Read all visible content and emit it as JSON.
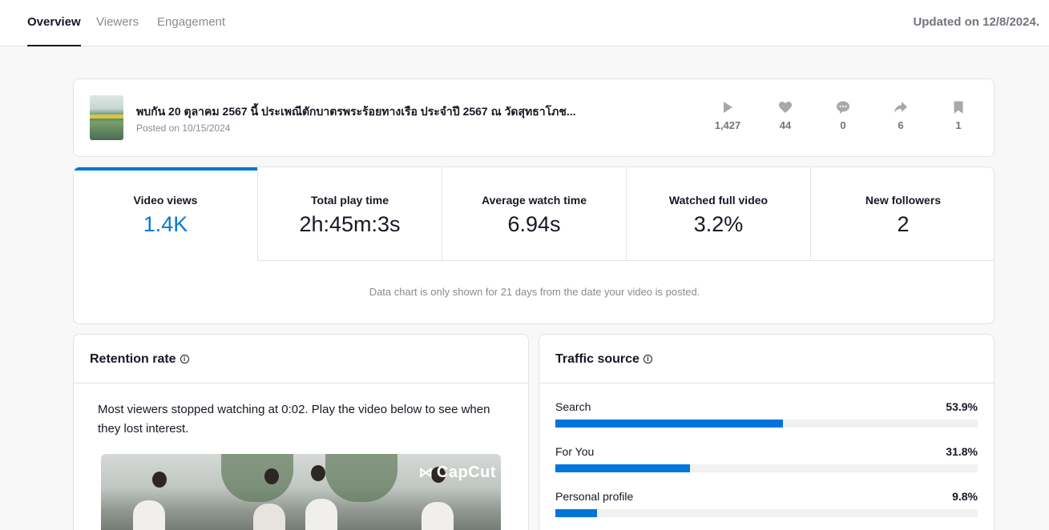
{
  "tabs": [
    {
      "label": "Overview",
      "active": true
    },
    {
      "label": "Viewers",
      "active": false
    },
    {
      "label": "Engagement",
      "active": false
    }
  ],
  "updated": "Updated on 12/8/2024.",
  "video": {
    "title": "พบกัน 20 ตุลาคม 2567 นี้ ประเพณีตักบาตรพระร้อยทางเรือ ประจำปี 2567 ณ วัดสุทธาโภช...",
    "posted": "Posted on 10/15/2024",
    "stats": {
      "plays": "1,427",
      "likes": "44",
      "comments": "0",
      "shares": "6",
      "saves": "1"
    }
  },
  "metrics": [
    {
      "label": "Video views",
      "value": "1.4K",
      "active": true
    },
    {
      "label": "Total play time",
      "value": "2h:45m:3s",
      "active": false
    },
    {
      "label": "Average watch time",
      "value": "6.94s",
      "active": false
    },
    {
      "label": "Watched full video",
      "value": "3.2%",
      "active": false
    },
    {
      "label": "New followers",
      "value": "2",
      "active": false
    }
  ],
  "chart_note": "Data chart is only shown for 21 days from the date your video is posted.",
  "retention": {
    "title": "Retention rate",
    "text": "Most viewers stopped watching at 0:02. Play the video below to see when they lost interest.",
    "watermark": "CapCut"
  },
  "traffic": {
    "title": "Traffic source",
    "sources": [
      {
        "label": "Search",
        "percent": "53.9%",
        "value": 53.9
      },
      {
        "label": "For You",
        "percent": "31.8%",
        "value": 31.8
      },
      {
        "label": "Personal profile",
        "percent": "9.8%",
        "value": 9.8
      }
    ]
  },
  "colors": {
    "accent": "#0075db",
    "accent_text": "#0b77d5"
  },
  "icons": {
    "plays": "play-icon",
    "likes": "heart-icon",
    "comments": "comment-icon",
    "shares": "share-icon",
    "saves": "bookmark-icon",
    "info": "info-icon"
  }
}
